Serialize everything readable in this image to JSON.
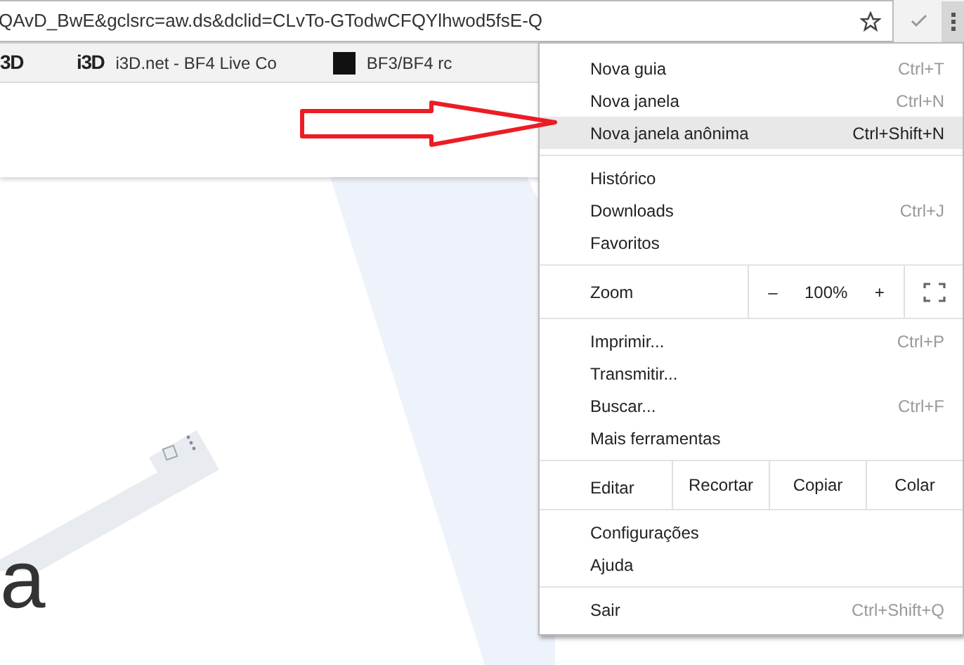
{
  "address_bar": {
    "url": "QAvD_BwE&gclsrc=aw.ds&dclid=CLvTo-GTodwCFQYlhwod5fsE-Q"
  },
  "bookmarks": [
    {
      "logo": "3D"
    },
    {
      "logo": "i3D",
      "label": "i3D.net - BF4 Live Co"
    },
    {
      "label": "BF3/BF4 rc"
    }
  ],
  "page": {
    "heading_fragment": "a"
  },
  "menu": {
    "sections": [
      {
        "kind": "items",
        "items": [
          {
            "label": "Nova guia",
            "shortcut": "Ctrl+T",
            "selected": false
          },
          {
            "label": "Nova janela",
            "shortcut": "Ctrl+N",
            "selected": false
          },
          {
            "label": "Nova janela anônima",
            "shortcut": "Ctrl+Shift+N",
            "selected": true
          }
        ]
      },
      {
        "kind": "items",
        "items": [
          {
            "label": "Histórico",
            "selected": false
          },
          {
            "label": "Downloads",
            "shortcut": "Ctrl+J",
            "selected": false
          },
          {
            "label": "Favoritos",
            "selected": false
          }
        ]
      },
      {
        "kind": "zoom",
        "label": "Zoom",
        "minus": "–",
        "value": "100%",
        "plus": "+"
      },
      {
        "kind": "items",
        "items": [
          {
            "label": "Imprimir...",
            "shortcut": "Ctrl+P",
            "selected": false
          },
          {
            "label": "Transmitir...",
            "selected": false
          },
          {
            "label": "Buscar...",
            "shortcut": "Ctrl+F",
            "selected": false
          },
          {
            "label": "Mais ferramentas",
            "selected": false
          }
        ]
      },
      {
        "kind": "edit",
        "label": "Editar",
        "buttons": [
          "Recortar",
          "Copiar",
          "Colar"
        ]
      },
      {
        "kind": "items",
        "items": [
          {
            "label": "Configurações",
            "selected": false
          },
          {
            "label": "Ajuda",
            "selected": false
          }
        ]
      },
      {
        "kind": "items",
        "items": [
          {
            "label": "Sair",
            "shortcut": "Ctrl+Shift+Q",
            "selected": false
          }
        ]
      }
    ]
  }
}
